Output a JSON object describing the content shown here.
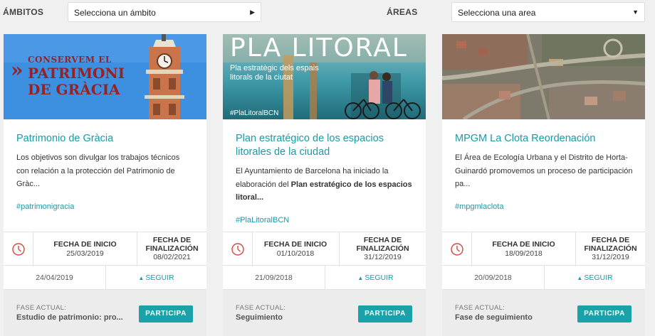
{
  "filters": {
    "ambitos_label": "ÁMBITOS",
    "ambitos_value": "Selecciona un ámbito",
    "areas_label": "ÁREAS",
    "areas_value": "Selecciona una area"
  },
  "cards": [
    {
      "image": {
        "line1": "CONSERVEM EL",
        "line2": "PATRIMONI",
        "line3": "DE GRÀCIA",
        "colors": {
          "sky": "#3d8fe0",
          "text": "#9a2121"
        }
      },
      "title": "Patrimonio de Gràcia",
      "desc": "Los objetivos son divulgar los trabajos técnicos con relación a la protección del Patrimonio de Gràc...",
      "tag": "#patrimonigracia",
      "start_label": "FECHA DE INICIO",
      "start_date": "25/03/2019",
      "end_label_1": "FECHA DE",
      "end_label_2": "FINALIZACIÓN",
      "end_date": "08/02/2021",
      "published": "24/04/2019",
      "follow": "SEGUIR",
      "phase_label": "FASE ACTUAL:",
      "phase_value": "Estudio de patrimonio: pro...",
      "button": "PARTICIPA"
    },
    {
      "image": {
        "title": "PLA LITORAL",
        "subtitle_1": "Pla estratègic dels espais",
        "subtitle_2": "litorals de la ciutat",
        "hashtag": "#PlaLitoralBCN"
      },
      "title": "Plan estratégico de los espacios litorales de la ciudad",
      "desc_prefix": "El Ayuntamiento de Barcelona ha iniciado la elaboración del ",
      "desc_bold": "Plan estratégico de los espacios litoral...",
      "tag": "#PlaLitoralBCN",
      "start_label": "FECHA DE INICIO",
      "start_date": "01/10/2018",
      "end_label_1": "FECHA DE",
      "end_label_2": "FINALIZACIÓN",
      "end_date": "31/12/2019",
      "published": "21/09/2018",
      "follow": "SEGUIR",
      "phase_label": "FASE ACTUAL:",
      "phase_value": "Seguimiento",
      "button": "PARTICIPA"
    },
    {
      "title": "MPGM La Clota Reordenación",
      "desc": "El Área de Ecología Urbana y el Distrito de Horta-Guinardó promovemos un proceso de participación pa...",
      "tag": "#mpgmlaclota",
      "start_label": "FECHA DE INICIO",
      "start_date": "18/09/2018",
      "end_label_1": "FECHA DE",
      "end_label_2": "FINALIZACIÓN",
      "end_date": "31/12/2019",
      "published": "20/09/2018",
      "follow": "SEGUIR",
      "phase_label": "FASE ACTUAL:",
      "phase_value": "Fase de seguimiento",
      "button": "PARTICIPA"
    }
  ],
  "accent_color": "#1aa2a8",
  "clock_color": "#d9463b"
}
